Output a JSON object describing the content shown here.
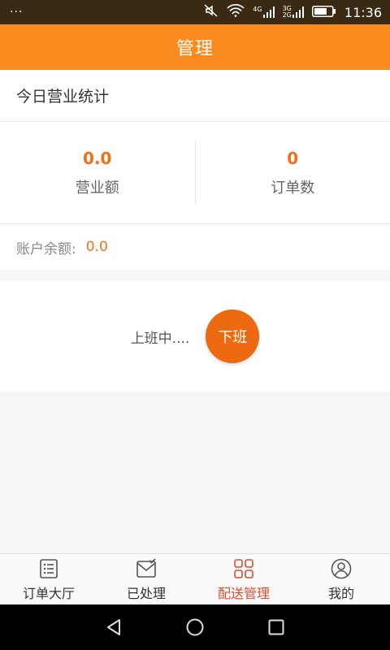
{
  "status_bar": {
    "notifications": "···",
    "network_4g": "4G",
    "network_3g": "3G",
    "network_2g": "2G",
    "time": "11:36"
  },
  "header": {
    "title": "管理"
  },
  "today_stats": {
    "title": "今日营业统计",
    "revenue_value": "0.0",
    "revenue_label": "营业额",
    "orders_value": "0",
    "orders_label": "订单数"
  },
  "account": {
    "balance_label": "账户余额:",
    "balance_value": "0.0"
  },
  "duty": {
    "status_text": "上班中....",
    "off_duty_button": "下班"
  },
  "tabs": [
    {
      "label": "订单大厅",
      "icon": "list-icon"
    },
    {
      "label": "已处理",
      "icon": "inbox-check-icon"
    },
    {
      "label": "配送管理",
      "icon": "grid-icon",
      "active": true
    },
    {
      "label": "我的",
      "icon": "user-icon"
    }
  ],
  "colors": {
    "header": "#fb8a1f",
    "accent": "#f07016",
    "button": "#ee6a10",
    "active_tab": "#e2492b"
  }
}
